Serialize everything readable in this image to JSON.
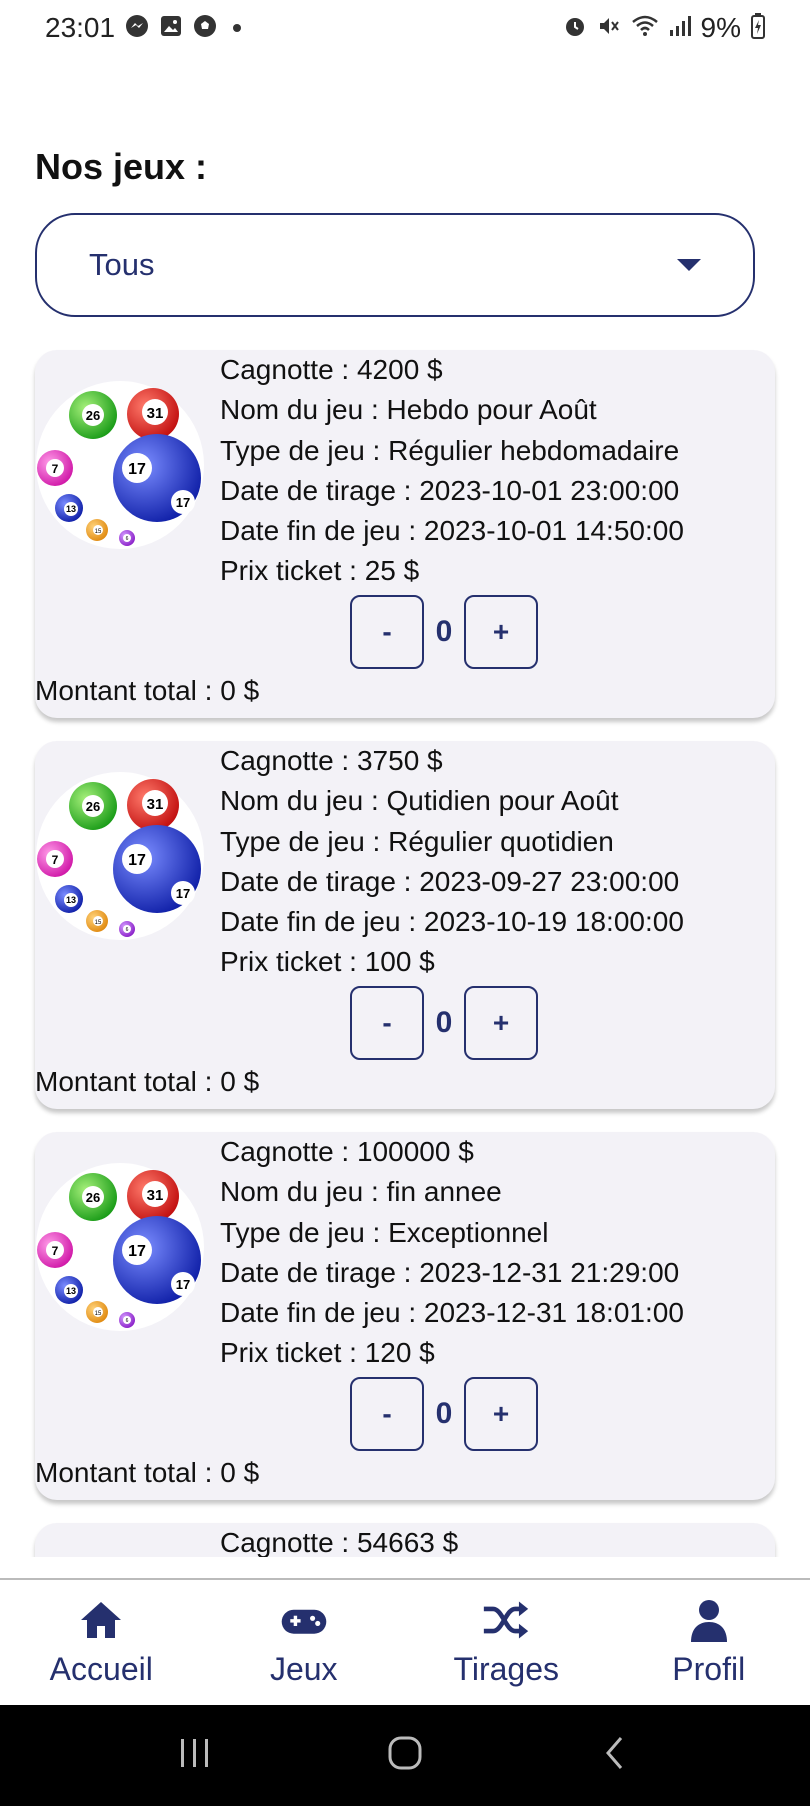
{
  "status_bar": {
    "time": "23:01",
    "battery": "9%",
    "left_icons": [
      "messenger-icon",
      "image-icon",
      "soccer-ball-icon",
      "notification-dot"
    ],
    "right_icons": [
      "alarm-icon",
      "mute-icon",
      "wifi-icon",
      "signal-icon",
      "battery-charging-icon"
    ]
  },
  "page": {
    "title": "Nos jeux :"
  },
  "filter": {
    "selected": "Tous"
  },
  "games": [
    {
      "cagnotte": "Cagnotte : 4200 $",
      "nom": "Nom du jeu : Hebdo pour Août",
      "type": "Type de jeu : Régulier hebdomadaire",
      "date_tirage": "Date de tirage : 2023-10-01 23:00:00",
      "date_fin": "Date fin de jeu : 2023-10-01 14:50:00",
      "prix": "Prix ticket : 25 $",
      "quantity": "0",
      "minus": "-",
      "plus": "+",
      "total": "Montant total : 0 $"
    },
    {
      "cagnotte": "Cagnotte : 3750 $",
      "nom": "Nom du jeu : Qutidien pour Août",
      "type": "Type de jeu : Régulier quotidien",
      "date_tirage": "Date de tirage : 2023-09-27 23:00:00",
      "date_fin": "Date fin de jeu : 2023-10-19 18:00:00",
      "prix": "Prix ticket : 100 $",
      "quantity": "0",
      "minus": "-",
      "plus": "+",
      "total": "Montant total : 0 $"
    },
    {
      "cagnotte": "Cagnotte : 100000 $",
      "nom": "Nom du jeu : fin annee",
      "type": "Type de jeu : Exceptionnel",
      "date_tirage": "Date de tirage : 2023-12-31 21:29:00",
      "date_fin": "Date fin de jeu : 2023-12-31 18:01:00",
      "prix": "Prix ticket : 120 $",
      "quantity": "0",
      "minus": "-",
      "plus": "+",
      "total": "Montant total : 0 $"
    },
    {
      "cagnotte": "Cagnotte : 54663 $"
    }
  ],
  "lottery_balls": [
    "26",
    "31",
    "7",
    "17",
    "17",
    "13",
    "15",
    "6"
  ],
  "bottom_nav": [
    {
      "label": "Accueil",
      "icon": "home-icon"
    },
    {
      "label": "Jeux",
      "icon": "gamepad-icon"
    },
    {
      "label": "Tirages",
      "icon": "shuffle-icon"
    },
    {
      "label": "Profil",
      "icon": "user-icon"
    }
  ],
  "colors": {
    "accent": "#25306e",
    "card_bg": "#f3f2f7",
    "system_nav": "#000000"
  }
}
